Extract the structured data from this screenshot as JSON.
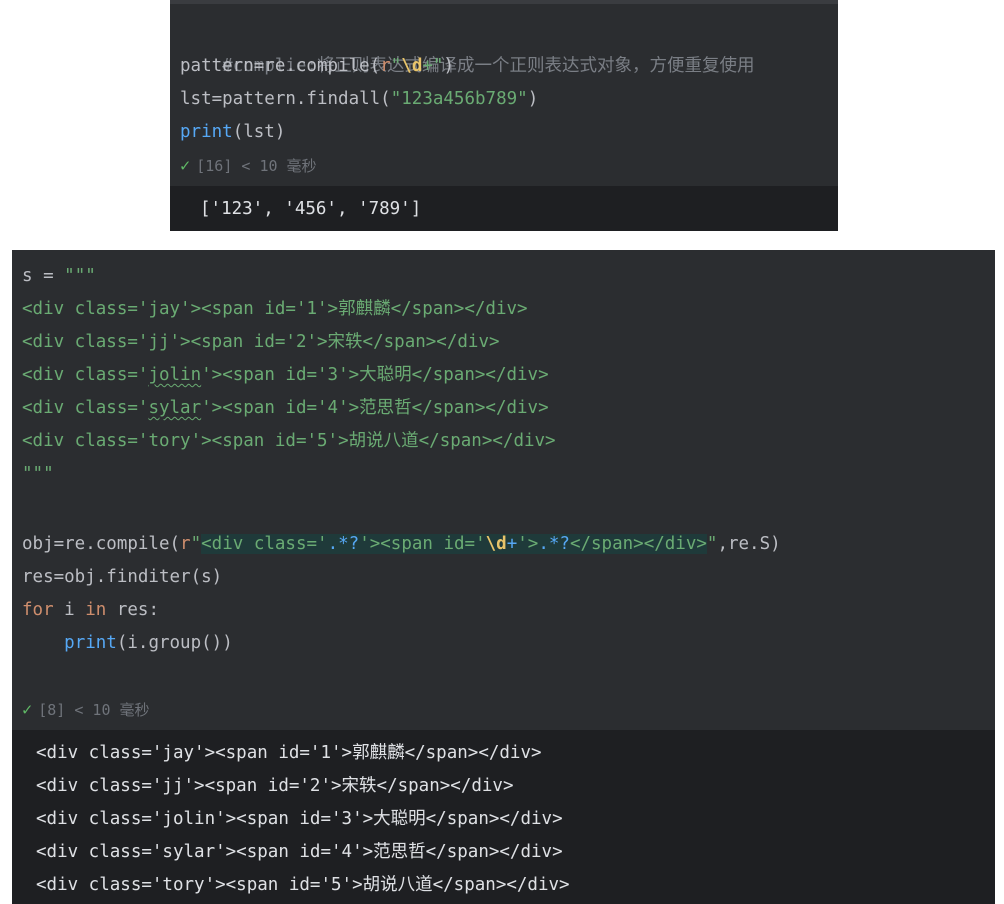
{
  "cell1": {
    "code": {
      "l1": "#complie:将正则表达式编译成一个正则表达式对象，方便重复使用",
      "l2_a": "pattern=re.compile(",
      "l2_prefix": "r",
      "l2_q1": "\"",
      "l2_esc": "\\d",
      "l2_plus": "+",
      "l2_q2": "\"",
      "l2_b": ")",
      "l3_a": "lst=pattern.findall(",
      "l3_str": "\"123a456b789\"",
      "l3_b": ")",
      "l4_fn": "print",
      "l4_rest": "(lst)"
    },
    "status": {
      "text": "[16] < 10 毫秒"
    },
    "output": [
      "['123', '456', '789']"
    ]
  },
  "cell2": {
    "code": {
      "s_assign": "s = ",
      "s_open": "\"\"\"",
      "html_lines": [
        {
          "pre": "<div class='",
          "cls": "jay",
          "post": "'><span id='1'>郭麒麟</span></div>",
          "squiggle": false
        },
        {
          "pre": "<div class='",
          "cls": "jj",
          "post": "'><span id='2'>宋轶</span></div>",
          "squiggle": false
        },
        {
          "pre": "<div class='",
          "cls": "jolin",
          "post": "'><span id='3'>大聪明</span></div>",
          "squiggle": true
        },
        {
          "pre": "<div class='",
          "cls": "sylar",
          "post": "'><span id='4'>范思哲</span></div>",
          "squiggle": true
        },
        {
          "pre": "<div class='",
          "cls": "tory",
          "post": "'><span id='5'>胡说八道</span></div>",
          "squiggle": false
        }
      ],
      "s_close": "\"\"\"",
      "obj_a": "obj=re.compile(",
      "obj_prefix": "r",
      "obj_q1": "\"",
      "obj_r1": "<div class='",
      "obj_r2": ".*?",
      "obj_r3": "'><span id='",
      "obj_r4": "\\d",
      "obj_r5": "+",
      "obj_r6": "'>",
      "obj_r7": ".*?",
      "obj_r8": "</span></div>",
      "obj_q2": "\"",
      "obj_b": ",re.S)",
      "res_line": "res=obj.finditer(s)",
      "for_kw": "for",
      "for_var": " i ",
      "in_kw": "in",
      "for_rest": " res:",
      "print_indent": "    ",
      "print_fn": "print",
      "print_rest": "(i.group())"
    },
    "status": {
      "text": "[8] < 10 毫秒"
    },
    "output": [
      "<div class='jay'><span id='1'>郭麒麟</span></div>",
      "<div class='jj'><span id='2'>宋轶</span></div>",
      "<div class='jolin'><span id='3'>大聪明</span></div>",
      "<div class='sylar'><span id='4'>范思哲</span></div>",
      "<div class='tory'><span id='5'>胡说八道</span></div>"
    ]
  },
  "icons": {
    "success": "check-icon"
  },
  "colors": {
    "cell_bg": "#2b2d30",
    "output_bg": "#1e1f22",
    "success": "#5fb865"
  }
}
